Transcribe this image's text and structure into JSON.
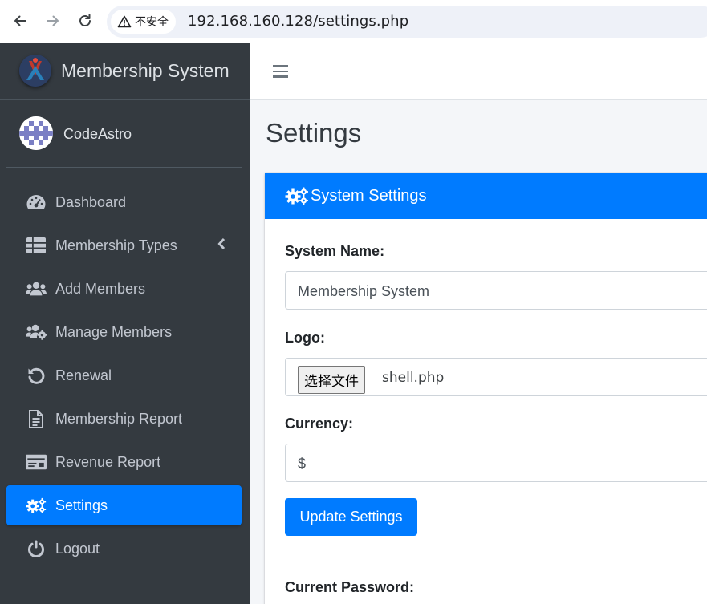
{
  "browser": {
    "security_label": "不安全",
    "url": "192.168.160.128/settings.php"
  },
  "brand": {
    "title": "Membership System"
  },
  "user": {
    "name": "CodeAstro"
  },
  "sidebar": {
    "items": [
      {
        "label": "Dashboard",
        "icon": "dashboard-icon"
      },
      {
        "label": "Membership Types",
        "icon": "table-icon"
      },
      {
        "label": "Add Members",
        "icon": "users-icon"
      },
      {
        "label": "Manage Members",
        "icon": "users-cog-icon"
      },
      {
        "label": "Renewal",
        "icon": "undo-icon"
      },
      {
        "label": "Membership Report",
        "icon": "file-report-icon"
      },
      {
        "label": "Revenue Report",
        "icon": "money-check-icon"
      },
      {
        "label": "Settings",
        "icon": "cogs-icon",
        "active": true
      },
      {
        "label": "Logout",
        "icon": "power-icon"
      }
    ]
  },
  "page": {
    "title": "Settings"
  },
  "card": {
    "title": "System Settings",
    "system_name_label": "System Name:",
    "system_name_value": "Membership System",
    "logo_label": "Logo:",
    "file_button": "选择文件",
    "file_name": "shell.php",
    "currency_label": "Currency:",
    "currency_value": "$",
    "submit_label": "Update Settings",
    "current_password_label": "Current Password:"
  },
  "colors": {
    "primary": "#007bff",
    "sidebar_bg": "#343a40",
    "sidebar_text": "#c2c7d0"
  }
}
